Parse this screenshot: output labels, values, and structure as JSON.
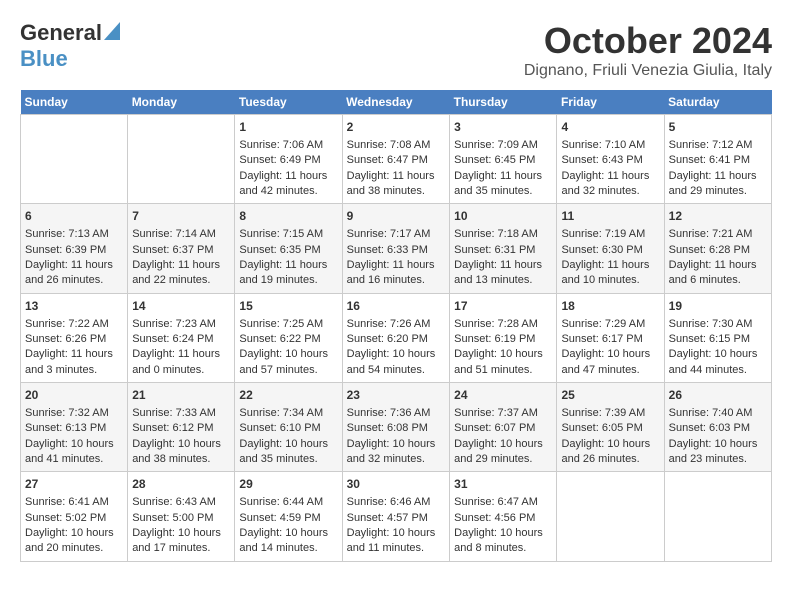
{
  "header": {
    "logo_general": "General",
    "logo_blue": "Blue",
    "title": "October 2024",
    "subtitle": "Dignano, Friuli Venezia Giulia, Italy"
  },
  "days_of_week": [
    "Sunday",
    "Monday",
    "Tuesday",
    "Wednesday",
    "Thursday",
    "Friday",
    "Saturday"
  ],
  "weeks": [
    [
      {
        "day": "",
        "content": ""
      },
      {
        "day": "",
        "content": ""
      },
      {
        "day": "1",
        "content": "Sunrise: 7:06 AM\nSunset: 6:49 PM\nDaylight: 11 hours and 42 minutes."
      },
      {
        "day": "2",
        "content": "Sunrise: 7:08 AM\nSunset: 6:47 PM\nDaylight: 11 hours and 38 minutes."
      },
      {
        "day": "3",
        "content": "Sunrise: 7:09 AM\nSunset: 6:45 PM\nDaylight: 11 hours and 35 minutes."
      },
      {
        "day": "4",
        "content": "Sunrise: 7:10 AM\nSunset: 6:43 PM\nDaylight: 11 hours and 32 minutes."
      },
      {
        "day": "5",
        "content": "Sunrise: 7:12 AM\nSunset: 6:41 PM\nDaylight: 11 hours and 29 minutes."
      }
    ],
    [
      {
        "day": "6",
        "content": "Sunrise: 7:13 AM\nSunset: 6:39 PM\nDaylight: 11 hours and 26 minutes."
      },
      {
        "day": "7",
        "content": "Sunrise: 7:14 AM\nSunset: 6:37 PM\nDaylight: 11 hours and 22 minutes."
      },
      {
        "day": "8",
        "content": "Sunrise: 7:15 AM\nSunset: 6:35 PM\nDaylight: 11 hours and 19 minutes."
      },
      {
        "day": "9",
        "content": "Sunrise: 7:17 AM\nSunset: 6:33 PM\nDaylight: 11 hours and 16 minutes."
      },
      {
        "day": "10",
        "content": "Sunrise: 7:18 AM\nSunset: 6:31 PM\nDaylight: 11 hours and 13 minutes."
      },
      {
        "day": "11",
        "content": "Sunrise: 7:19 AM\nSunset: 6:30 PM\nDaylight: 11 hours and 10 minutes."
      },
      {
        "day": "12",
        "content": "Sunrise: 7:21 AM\nSunset: 6:28 PM\nDaylight: 11 hours and 6 minutes."
      }
    ],
    [
      {
        "day": "13",
        "content": "Sunrise: 7:22 AM\nSunset: 6:26 PM\nDaylight: 11 hours and 3 minutes."
      },
      {
        "day": "14",
        "content": "Sunrise: 7:23 AM\nSunset: 6:24 PM\nDaylight: 11 hours and 0 minutes."
      },
      {
        "day": "15",
        "content": "Sunrise: 7:25 AM\nSunset: 6:22 PM\nDaylight: 10 hours and 57 minutes."
      },
      {
        "day": "16",
        "content": "Sunrise: 7:26 AM\nSunset: 6:20 PM\nDaylight: 10 hours and 54 minutes."
      },
      {
        "day": "17",
        "content": "Sunrise: 7:28 AM\nSunset: 6:19 PM\nDaylight: 10 hours and 51 minutes."
      },
      {
        "day": "18",
        "content": "Sunrise: 7:29 AM\nSunset: 6:17 PM\nDaylight: 10 hours and 47 minutes."
      },
      {
        "day": "19",
        "content": "Sunrise: 7:30 AM\nSunset: 6:15 PM\nDaylight: 10 hours and 44 minutes."
      }
    ],
    [
      {
        "day": "20",
        "content": "Sunrise: 7:32 AM\nSunset: 6:13 PM\nDaylight: 10 hours and 41 minutes."
      },
      {
        "day": "21",
        "content": "Sunrise: 7:33 AM\nSunset: 6:12 PM\nDaylight: 10 hours and 38 minutes."
      },
      {
        "day": "22",
        "content": "Sunrise: 7:34 AM\nSunset: 6:10 PM\nDaylight: 10 hours and 35 minutes."
      },
      {
        "day": "23",
        "content": "Sunrise: 7:36 AM\nSunset: 6:08 PM\nDaylight: 10 hours and 32 minutes."
      },
      {
        "day": "24",
        "content": "Sunrise: 7:37 AM\nSunset: 6:07 PM\nDaylight: 10 hours and 29 minutes."
      },
      {
        "day": "25",
        "content": "Sunrise: 7:39 AM\nSunset: 6:05 PM\nDaylight: 10 hours and 26 minutes."
      },
      {
        "day": "26",
        "content": "Sunrise: 7:40 AM\nSunset: 6:03 PM\nDaylight: 10 hours and 23 minutes."
      }
    ],
    [
      {
        "day": "27",
        "content": "Sunrise: 6:41 AM\nSunset: 5:02 PM\nDaylight: 10 hours and 20 minutes."
      },
      {
        "day": "28",
        "content": "Sunrise: 6:43 AM\nSunset: 5:00 PM\nDaylight: 10 hours and 17 minutes."
      },
      {
        "day": "29",
        "content": "Sunrise: 6:44 AM\nSunset: 4:59 PM\nDaylight: 10 hours and 14 minutes."
      },
      {
        "day": "30",
        "content": "Sunrise: 6:46 AM\nSunset: 4:57 PM\nDaylight: 10 hours and 11 minutes."
      },
      {
        "day": "31",
        "content": "Sunrise: 6:47 AM\nSunset: 4:56 PM\nDaylight: 10 hours and 8 minutes."
      },
      {
        "day": "",
        "content": ""
      },
      {
        "day": "",
        "content": ""
      }
    ]
  ]
}
